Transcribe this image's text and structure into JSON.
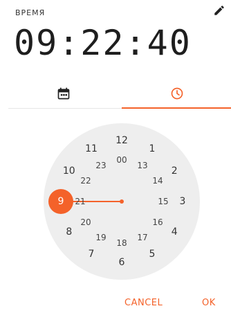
{
  "header": {
    "label": "ВРЕМЯ",
    "time": "09:22:40",
    "edit_icon": "pencil-icon"
  },
  "tabs": [
    {
      "name": "date",
      "icon": "calendar-icon",
      "selected": false
    },
    {
      "name": "time",
      "icon": "clock-icon",
      "selected": true
    }
  ],
  "clock": {
    "selected_hour": "9",
    "outer_numbers": [
      "12",
      "1",
      "2",
      "3",
      "4",
      "5",
      "6",
      "7",
      "8",
      "9",
      "10",
      "11"
    ],
    "inner_numbers": [
      "00",
      "13",
      "14",
      "15",
      "16",
      "17",
      "18",
      "19",
      "20",
      "21",
      "22",
      "23"
    ]
  },
  "actions": {
    "cancel": "CANCEL",
    "ok": "OK"
  },
  "colors": {
    "accent": "#f4622a",
    "clock_face": "#eeeeee",
    "text": "#222222"
  }
}
